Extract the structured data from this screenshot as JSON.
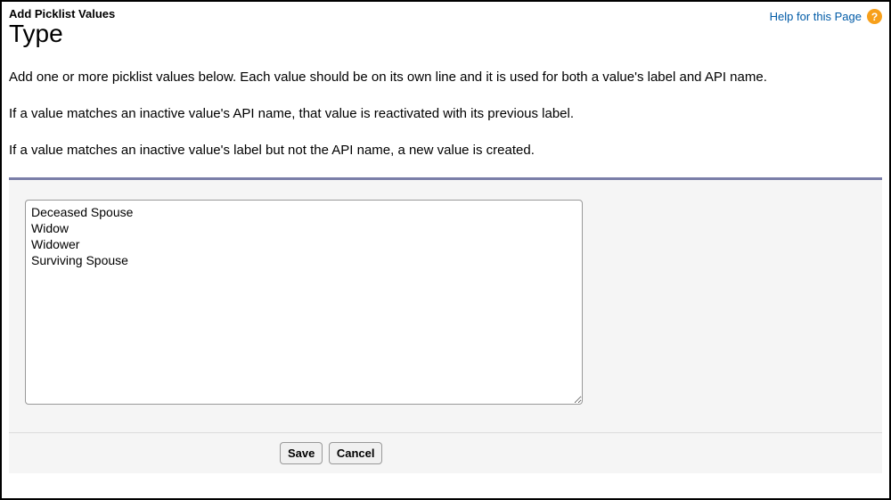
{
  "header": {
    "subtitle": "Add Picklist Values",
    "title": "Type",
    "help_link_text": "Help for this Page",
    "help_icon_char": "?"
  },
  "instructions": {
    "line1": "Add one or more picklist values below. Each value should be on its own line and it is used for both a value's label and API name.",
    "line2": "If a value matches an inactive value's API name, that value is reactivated with its previous label.",
    "line3": "If a value matches an inactive value's label but not the API name, a new value is created."
  },
  "form": {
    "textarea_value": "Deceased Spouse\nWidow\nWidower\nSurviving Spouse"
  },
  "buttons": {
    "save": "Save",
    "cancel": "Cancel"
  }
}
